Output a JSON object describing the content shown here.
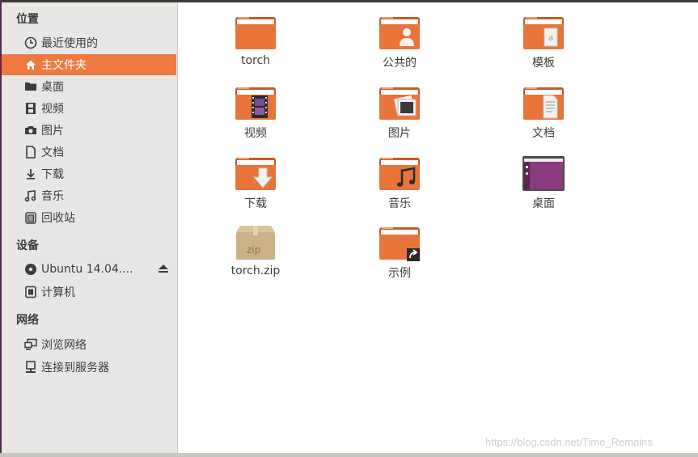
{
  "sidebar": {
    "sections": [
      {
        "title": "位置"
      },
      {
        "title": "设备"
      },
      {
        "title": "网络"
      }
    ],
    "places": [
      {
        "label": "最近使用的",
        "icon": "recent-clock-icon"
      },
      {
        "label": "主文件夹",
        "icon": "home-icon"
      },
      {
        "label": "桌面",
        "icon": "desktop-icon"
      },
      {
        "label": "视频",
        "icon": "video-icon"
      },
      {
        "label": "图片",
        "icon": "camera-icon"
      },
      {
        "label": "文档",
        "icon": "document-icon"
      },
      {
        "label": "下载",
        "icon": "download-icon"
      },
      {
        "label": "音乐",
        "icon": "music-icon"
      },
      {
        "label": "回收站",
        "icon": "trash-icon"
      }
    ],
    "devices": [
      {
        "label": "Ubuntu 14.04....",
        "icon": "disc-icon"
      },
      {
        "label": "计算机",
        "icon": "computer-icon"
      }
    ],
    "network": [
      {
        "label": "浏览网络",
        "icon": "network-icon"
      },
      {
        "label": "连接到服务器",
        "icon": "server-icon"
      }
    ],
    "active_item": "主文件夹",
    "active_color": "#ef7a3f"
  },
  "files": [
    {
      "name": "torch",
      "icon": "folder-icon"
    },
    {
      "name": "公共的",
      "icon": "folder-public-icon"
    },
    {
      "name": "模板",
      "icon": "folder-templates-icon"
    },
    {
      "name": "视频",
      "icon": "folder-videos-icon"
    },
    {
      "name": "图片",
      "icon": "folder-pictures-icon"
    },
    {
      "name": "文档",
      "icon": "folder-documents-icon"
    },
    {
      "name": "下载",
      "icon": "folder-download-icon"
    },
    {
      "name": "音乐",
      "icon": "folder-music-icon"
    },
    {
      "name": "桌面",
      "icon": "desktop-folder-icon"
    },
    {
      "name": "torch.zip",
      "icon": "zip-archive-icon"
    },
    {
      "name": "示例",
      "icon": "folder-link-icon"
    }
  ],
  "watermark": "https://blog.csdn.net/Time_Remains",
  "colors": {
    "folder": "#e8743b",
    "folder_light": "#f5a06c",
    "accent": "#ef7a3f"
  }
}
